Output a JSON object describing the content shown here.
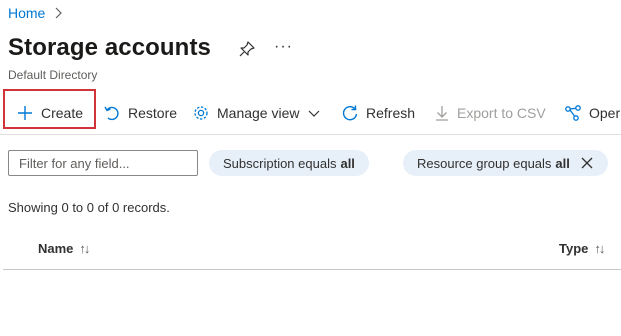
{
  "breadcrumb": {
    "home": "Home"
  },
  "header": {
    "title": "Storage accounts",
    "subtitle": "Default Directory",
    "more": "···"
  },
  "toolbar": {
    "create": "Create",
    "restore": "Restore",
    "manage_view": "Manage view",
    "refresh": "Refresh",
    "export_csv": "Export to CSV",
    "open": "Oper"
  },
  "filters": {
    "placeholder": "Filter for any field...",
    "subscription_label": "Subscription equals",
    "subscription_value": "all",
    "resource_group_label": "Resource group equals",
    "resource_group_value": "all"
  },
  "status": {
    "records": "Showing 0 to 0 of 0 records."
  },
  "table": {
    "columns": [
      {
        "label": "Name",
        "sort": "↑↓"
      },
      {
        "label": "Type",
        "sort": "↑↓"
      }
    ]
  },
  "colors": {
    "accent": "#0078d4",
    "highlight": "#d13438",
    "pill_bg": "#e7f0f8"
  }
}
